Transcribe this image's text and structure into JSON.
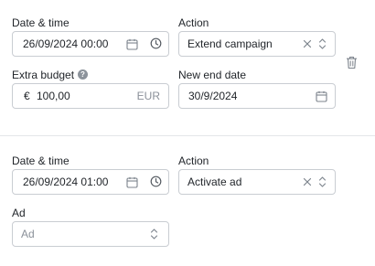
{
  "rule1": {
    "datetime_label": "Date & time",
    "datetime_value": "26/09/2024 00:00",
    "action_label": "Action",
    "action_value": "Extend campaign",
    "budget_label": "Extra budget",
    "budget_prefix": "€",
    "budget_value": "100,00",
    "budget_currency": "EUR",
    "enddate_label": "New end date",
    "enddate_value": "30/9/2024"
  },
  "rule2": {
    "datetime_label": "Date & time",
    "datetime_value": "26/09/2024 01:00",
    "action_label": "Action",
    "action_value": "Activate ad",
    "ad_label": "Ad",
    "ad_placeholder": "Ad"
  },
  "help_glyph": "?",
  "icons": [
    "calendar-icon",
    "clock-icon",
    "clear-icon",
    "chevron-updown-icon",
    "help-icon",
    "trash-icon"
  ],
  "colors": {
    "border": "#c9cdd2",
    "icon": "#7c838c",
    "text": "#1f2328",
    "divider": "#e4e6e9"
  }
}
